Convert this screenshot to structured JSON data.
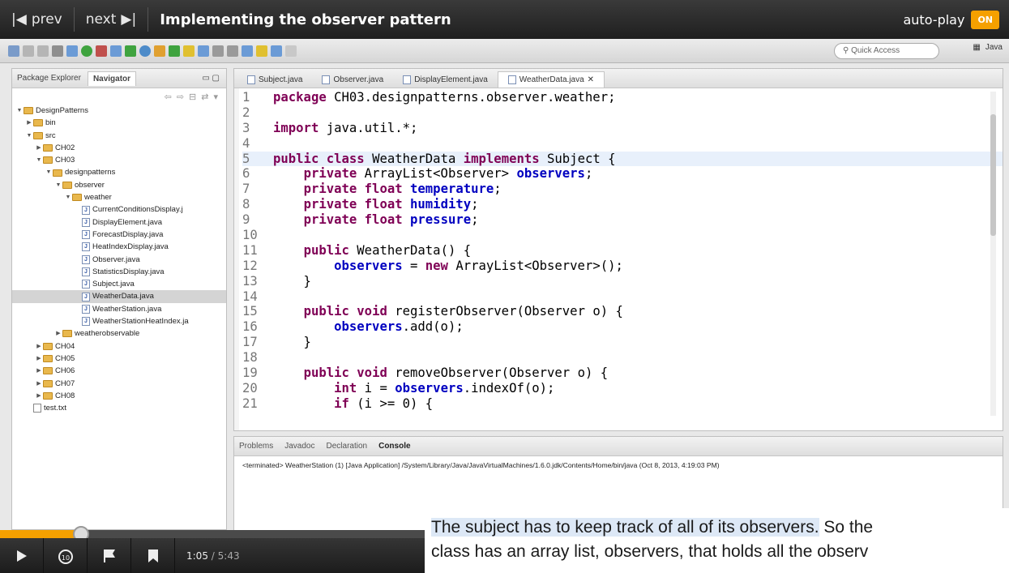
{
  "player": {
    "prev_label": "prev",
    "next_label": "next",
    "title": "Implementing the observer pattern",
    "autoplay_label": "auto-play",
    "autoplay_state": "ON",
    "current_time": "1:05",
    "duration": "5:43",
    "progress_fraction": 0.19
  },
  "toolbar": {
    "quick_access_placeholder": "Quick Access",
    "perspective_label": "Java"
  },
  "left_panel": {
    "tabs": [
      "Package Explorer",
      "Navigator"
    ],
    "tree": [
      {
        "label": "DesignPatterns",
        "indent": 0,
        "kind": "project",
        "expanded": true
      },
      {
        "label": "bin",
        "indent": 1,
        "kind": "folder",
        "expanded": false
      },
      {
        "label": "src",
        "indent": 1,
        "kind": "folder",
        "expanded": true
      },
      {
        "label": "CH02",
        "indent": 2,
        "kind": "folder",
        "expanded": false
      },
      {
        "label": "CH03",
        "indent": 2,
        "kind": "folder",
        "expanded": true
      },
      {
        "label": "designpatterns",
        "indent": 3,
        "kind": "folder",
        "expanded": true
      },
      {
        "label": "observer",
        "indent": 4,
        "kind": "folder",
        "expanded": true
      },
      {
        "label": "weather",
        "indent": 5,
        "kind": "folder",
        "expanded": true
      },
      {
        "label": "CurrentConditionsDisplay.j",
        "indent": 6,
        "kind": "java"
      },
      {
        "label": "DisplayElement.java",
        "indent": 6,
        "kind": "java"
      },
      {
        "label": "ForecastDisplay.java",
        "indent": 6,
        "kind": "java"
      },
      {
        "label": "HeatIndexDisplay.java",
        "indent": 6,
        "kind": "java"
      },
      {
        "label": "Observer.java",
        "indent": 6,
        "kind": "java"
      },
      {
        "label": "StatisticsDisplay.java",
        "indent": 6,
        "kind": "java"
      },
      {
        "label": "Subject.java",
        "indent": 6,
        "kind": "java"
      },
      {
        "label": "WeatherData.java",
        "indent": 6,
        "kind": "java",
        "selected": true
      },
      {
        "label": "WeatherStation.java",
        "indent": 6,
        "kind": "java"
      },
      {
        "label": "WeatherStationHeatIndex.ja",
        "indent": 6,
        "kind": "java"
      },
      {
        "label": "weatherobservable",
        "indent": 4,
        "kind": "folder",
        "expanded": false
      },
      {
        "label": "CH04",
        "indent": 2,
        "kind": "folder",
        "expanded": false
      },
      {
        "label": "CH05",
        "indent": 2,
        "kind": "folder",
        "expanded": false
      },
      {
        "label": "CH06",
        "indent": 2,
        "kind": "folder",
        "expanded": false
      },
      {
        "label": "CH07",
        "indent": 2,
        "kind": "folder",
        "expanded": false
      },
      {
        "label": "CH08",
        "indent": 2,
        "kind": "folder",
        "expanded": false
      },
      {
        "label": "test.txt",
        "indent": 1,
        "kind": "txt"
      }
    ]
  },
  "editor": {
    "tabs": [
      {
        "label": "Subject.java",
        "active": false
      },
      {
        "label": "Observer.java",
        "active": false
      },
      {
        "label": "DisplayElement.java",
        "active": false
      },
      {
        "label": "WeatherData.java",
        "active": true
      }
    ],
    "lines": [
      {
        "n": "1",
        "text": "package CH03.designpatterns.observer.weather;"
      },
      {
        "n": "2",
        "text": ""
      },
      {
        "n": "3",
        "text": "import java.util.*;"
      },
      {
        "n": "4",
        "text": ""
      },
      {
        "n": "5",
        "text": "public class WeatherData implements Subject {",
        "current": true
      },
      {
        "n": "6",
        "text": "    private ArrayList<Observer> observers;"
      },
      {
        "n": "7",
        "text": "    private float temperature;"
      },
      {
        "n": "8",
        "text": "    private float humidity;"
      },
      {
        "n": "9",
        "text": "    private float pressure;"
      },
      {
        "n": "10",
        "text": ""
      },
      {
        "n": "11",
        "text": "    public WeatherData() {"
      },
      {
        "n": "12",
        "text": "        observers = new ArrayList<Observer>();"
      },
      {
        "n": "13",
        "text": "    }"
      },
      {
        "n": "14",
        "text": ""
      },
      {
        "n": "15",
        "text": "    public void registerObserver(Observer o) {"
      },
      {
        "n": "16",
        "text": "        observers.add(o);"
      },
      {
        "n": "17",
        "text": "    }"
      },
      {
        "n": "18",
        "text": ""
      },
      {
        "n": "19",
        "text": "    public void removeObserver(Observer o) {"
      },
      {
        "n": "20",
        "text": "        int i = observers.indexOf(o);"
      },
      {
        "n": "21",
        "text": "        if (i >= 0) {"
      }
    ]
  },
  "console": {
    "tabs": [
      "Problems",
      "Javadoc",
      "Declaration",
      "Console"
    ],
    "active_tab": "Console",
    "text": "<terminated> WeatherStation (1) [Java Application] /System/Library/Java/JavaVirtualMachines/1.6.0.jdk/Contents/Home/bin/java (Oct 8, 2013, 4:19:03 PM)"
  },
  "caption": {
    "highlight": "The subject has to keep track of all of its observers.",
    "rest1": " So the",
    "line2": "class has an array list, observers, that holds all the observ"
  },
  "colors": {
    "accent": "#f5a000",
    "keyword": "#7f0055",
    "field": "#0000c0"
  }
}
